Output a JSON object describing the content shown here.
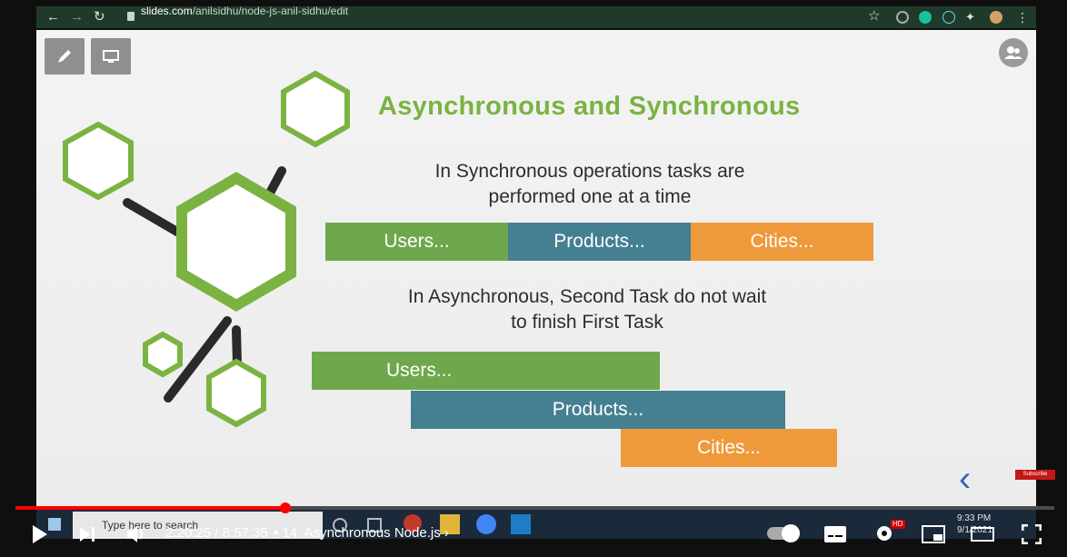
{
  "browser": {
    "back_icon": "arrow-left-icon",
    "forward_icon": "arrow-right-icon",
    "reload_icon": "reload-icon",
    "url_domain": "slides.com",
    "url_path": "/anilsidhu/node-js-anil-sidhu/edit"
  },
  "slide": {
    "title": "Asynchronous and Synchronous",
    "sync_text_line1": "In Synchronous operations tasks are",
    "sync_text_line2": "performed one at a time",
    "sync_bars": [
      "Users...",
      "Products...",
      "Cities..."
    ],
    "async_text_line1": "In Asynchronous, Second Task do not wait",
    "async_text_line2": "to finish First Task",
    "async_bars": [
      "Users...",
      "Products...",
      "Cities..."
    ],
    "colors": {
      "green": "#6fa84c",
      "blue": "#457f92",
      "orange": "#ee9a3b",
      "title": "#7bb342"
    }
  },
  "subscribe_label": "Subscribe",
  "taskbar": {
    "search_placeholder": "Type here to search",
    "time": "9:33 PM",
    "date": "9/1/2021"
  },
  "player": {
    "current_time": "2:20:25",
    "separator": " / ",
    "duration": "8:57:35",
    "chapter": "14. Asynchronous Node.js",
    "chapter_bullet": "•",
    "hd_badge": "HD",
    "progress_fraction": 0.26
  }
}
